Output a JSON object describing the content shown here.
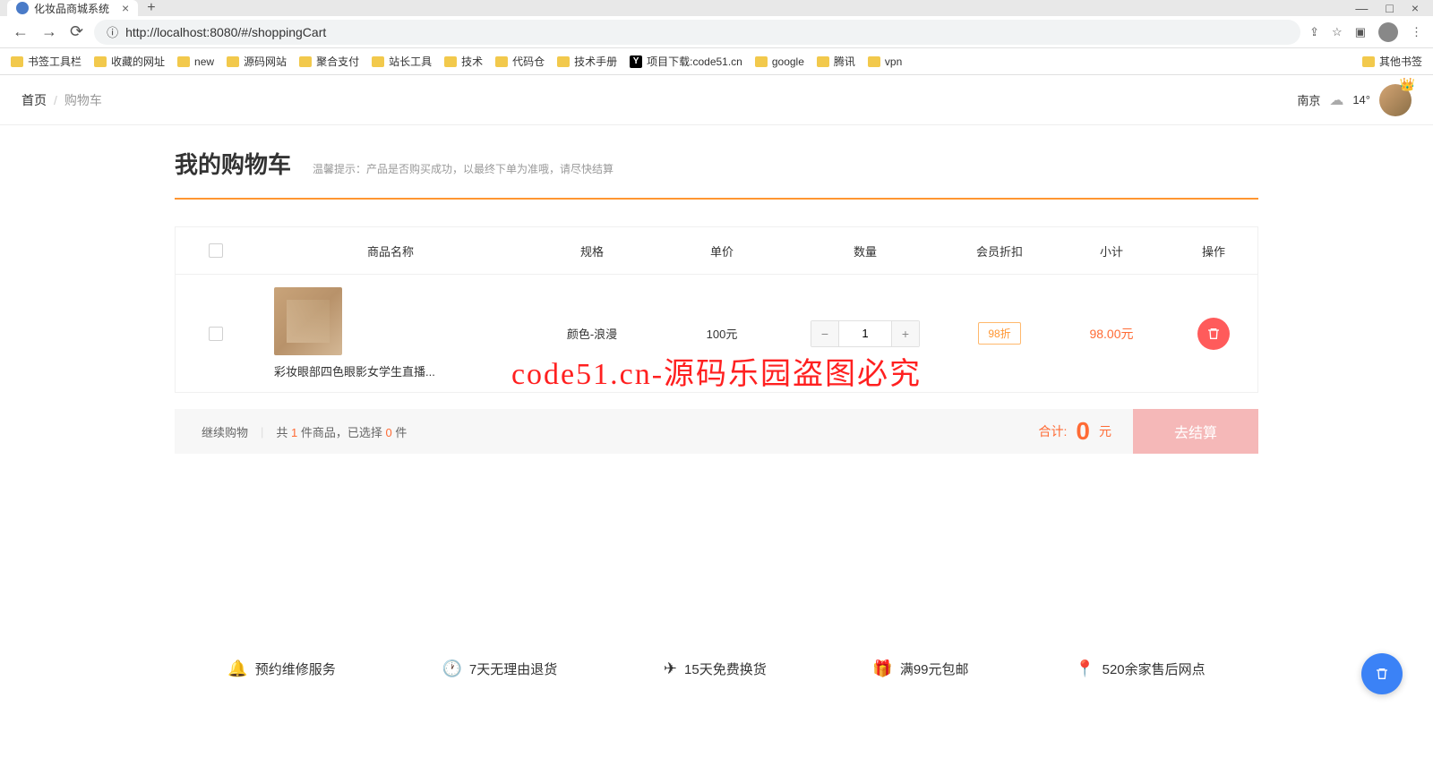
{
  "browser": {
    "tab_title": "化妆品商城系统",
    "url": "http://localhost:8080/#/shoppingCart",
    "bookmarks": [
      "书签工具栏",
      "收藏的网址",
      "new",
      "源码网站",
      "聚合支付",
      "站长工具",
      "技术",
      "代码仓",
      "技术手册",
      "项目下载:code51.cn",
      "google",
      "腾讯",
      "vpn"
    ],
    "other_bookmarks": "其他书签"
  },
  "header": {
    "home": "首页",
    "current": "购物车",
    "city": "南京",
    "temp": "14°"
  },
  "page": {
    "title": "我的购物车",
    "tip": "温馨提示：产品是否购买成功，以最终下单为准哦，请尽快结算"
  },
  "columns": {
    "name": "商品名称",
    "spec": "规格",
    "price": "单价",
    "qty": "数量",
    "discount": "会员折扣",
    "subtotal": "小计",
    "action": "操作"
  },
  "item": {
    "name": "彩妆眼部四色眼影女学生直播...",
    "spec": "颜色-浪漫",
    "price": "100元",
    "qty": "1",
    "discount": "98折",
    "subtotal": "98.00元"
  },
  "summary": {
    "continue": "继续购物",
    "count_prefix": "共 ",
    "count": "1",
    "count_suffix": " 件商品，已选择 ",
    "selected": "0",
    "selected_suffix": " 件",
    "total_label": "合计: ",
    "total_amount": "0",
    "total_unit": " 元",
    "checkout": "去结算"
  },
  "watermark": "code51.cn-源码乐园盗图必究",
  "footer": {
    "s1": "预约维修服务",
    "s2": "7天无理由退货",
    "s3": "15天免费换货",
    "s4": "满99元包邮",
    "s5": "520余家售后网点"
  }
}
